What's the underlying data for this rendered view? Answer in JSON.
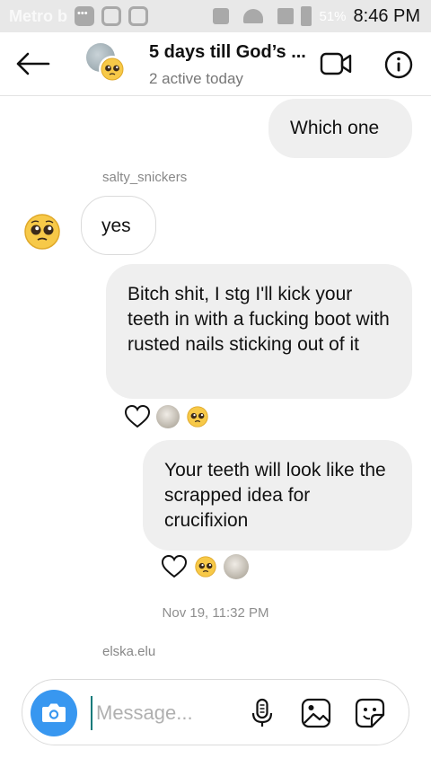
{
  "status_bar": {
    "carrier": "Metro b",
    "battery": "51%",
    "time": "8:46 PM"
  },
  "header": {
    "title": "5 days till God’s ...",
    "subtitle": "2 active today"
  },
  "messages": [
    {
      "text": "Which one"
    },
    {
      "sender": "salty_snickers",
      "text": "yes"
    },
    {
      "text": "Bitch shit, I stg I'll kick your teeth in with a fucking boot with rusted nails sticking out of it"
    },
    {
      "text": "Your teeth will look like the scrapped idea for crucifixion"
    }
  ],
  "timestamp": "Nov 19, 11:32 PM",
  "typing_sender": "elska.elu",
  "composer": {
    "placeholder": "Message..."
  },
  "icons": {
    "back": "arrow-left-icon",
    "video": "video-camera-icon",
    "info": "info-icon",
    "camera": "camera-icon",
    "mic": "microphone-icon",
    "gallery": "image-icon",
    "sticker": "sticker-icon",
    "like": "heart-icon"
  },
  "colors": {
    "accent": "#3897f0",
    "bubble": "#efefef",
    "emoji_yellow": "#f7c948"
  }
}
